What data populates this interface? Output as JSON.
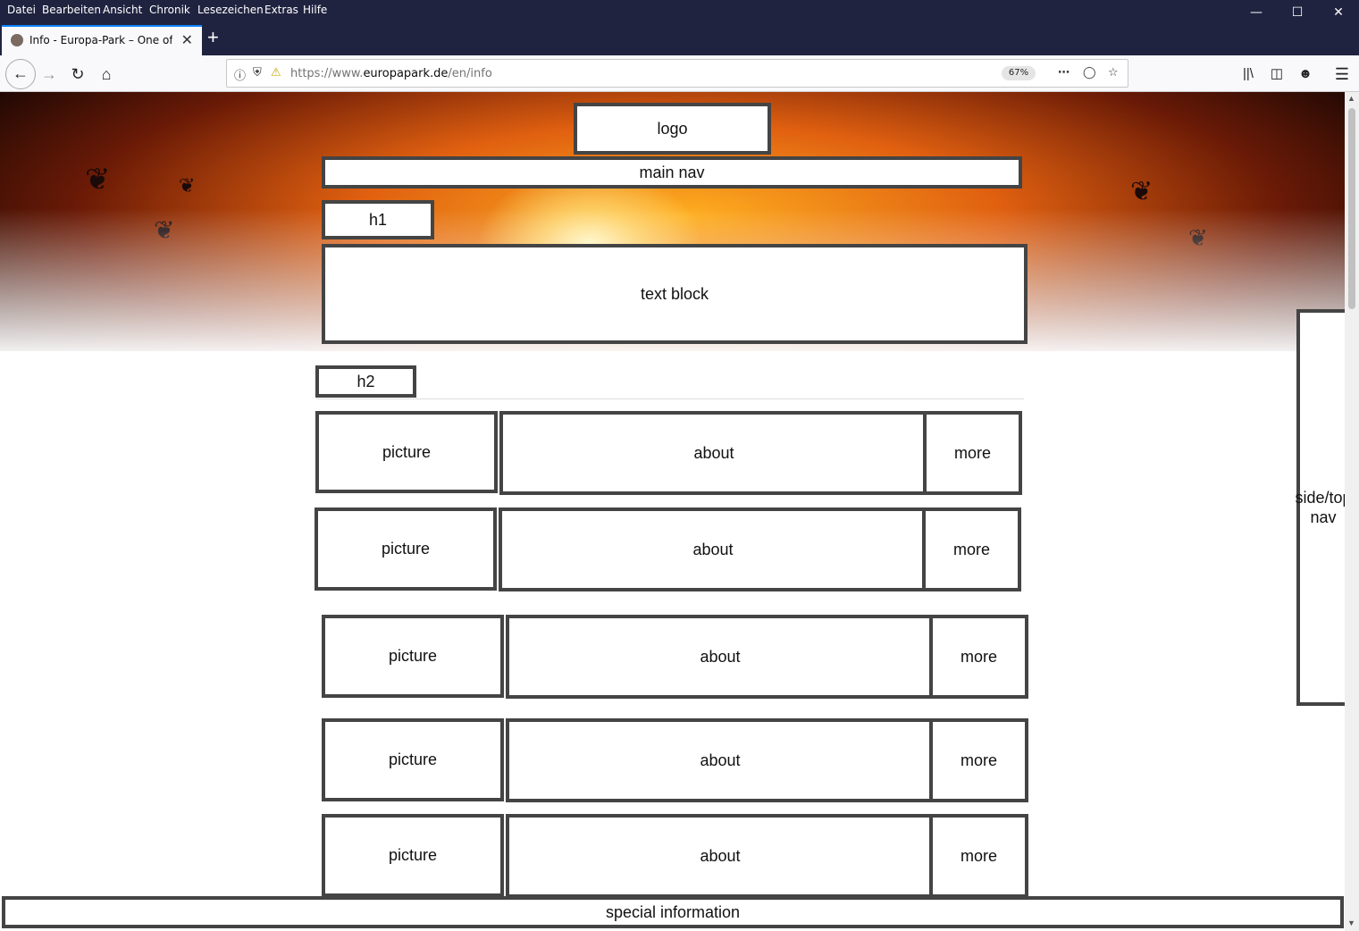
{
  "browser": {
    "menu": [
      "Datei",
      "Bearbeiten",
      "Ansicht",
      "Chronik",
      "Lesezeichen",
      "Extras",
      "Hilfe"
    ],
    "tab_title": "Info - Europa-Park – One of the",
    "url_prefix": "https://www.",
    "url_domain": "europapark.de",
    "url_path": "/en/info",
    "zoom": "67%"
  },
  "wireframe": {
    "logo": "logo",
    "main_nav": "main nav",
    "h1": "h1",
    "text_block": "text block",
    "h2": "h2",
    "rows": [
      {
        "picture": "picture",
        "about": "about",
        "more": "more"
      },
      {
        "picture": "picture",
        "about": "about",
        "more": "more"
      },
      {
        "picture": "picture",
        "about": "about",
        "more": "more"
      },
      {
        "picture": "picture",
        "about": "about",
        "more": "more"
      },
      {
        "picture": "picture",
        "about": "about",
        "more": "more"
      }
    ],
    "side_nav": "side/top nav",
    "special_info": "special information"
  }
}
